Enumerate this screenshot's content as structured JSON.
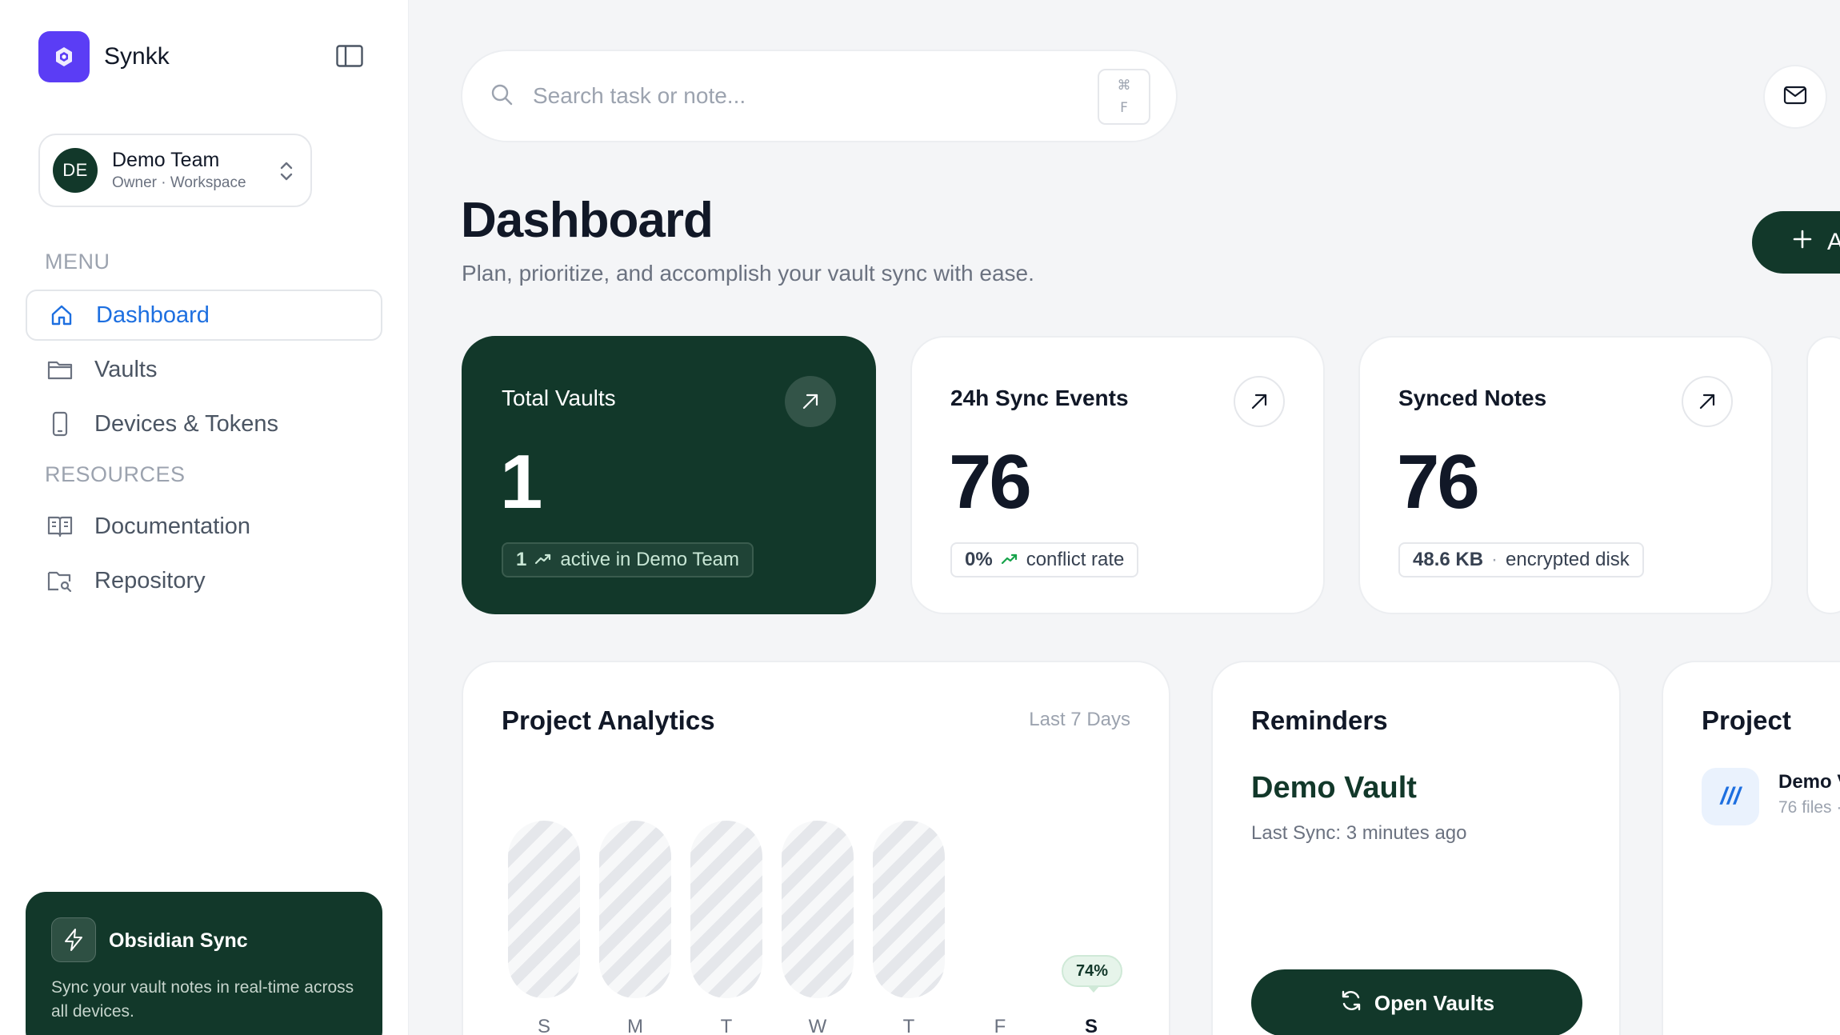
{
  "app": {
    "name": "Synkk"
  },
  "team": {
    "initials": "DE",
    "name": "Demo Team",
    "role": "Owner · Workspace"
  },
  "sidebar": {
    "menu_label": "MENU",
    "menu_items": [
      {
        "label": "Dashboard",
        "icon": "home-icon",
        "active": true
      },
      {
        "label": "Vaults",
        "icon": "folder-icon"
      },
      {
        "label": "Devices & Tokens",
        "icon": "phone-icon"
      }
    ],
    "resources_label": "RESOURCES",
    "resource_items": [
      {
        "label": "Documentation",
        "icon": "book-icon"
      },
      {
        "label": "Repository",
        "icon": "repo-icon"
      }
    ],
    "promo": {
      "title": "Obsidian Sync",
      "description": "Sync your vault notes in real-time across all devices."
    }
  },
  "search": {
    "placeholder": "Search task or note...",
    "shortcut_mod": "⌘",
    "shortcut_key": "F"
  },
  "header": {
    "title": "Dashboard",
    "subtitle": "Plan, prioritize, and accomplish your vault sync with ease.",
    "add_button_label": "A"
  },
  "stats": [
    {
      "label": "Total Vaults",
      "value": "1",
      "pill_strong": "1",
      "pill_text": "active in Demo Team",
      "trend_icon": "trend-up-icon"
    },
    {
      "label": "24h Sync Events",
      "value": "76",
      "pill_strong": "0%",
      "pill_text": "conflict rate",
      "trend_icon": "trend-up-icon"
    },
    {
      "label": "Synced Notes",
      "value": "76",
      "pill_strong": "48.6 KB",
      "pill_sep": "·",
      "pill_text": "encrypted disk"
    }
  ],
  "analytics": {
    "title": "Project Analytics",
    "range": "Last 7 Days",
    "days": [
      "S",
      "M",
      "T",
      "W",
      "T",
      "F",
      "S"
    ],
    "highlight": "74%"
  },
  "chart_data": {
    "type": "bar",
    "categories": [
      "S",
      "M",
      "T",
      "W",
      "T",
      "F",
      "S"
    ],
    "annotations": [
      {
        "category": "S",
        "text": "74%"
      }
    ]
  },
  "reminders": {
    "title": "Reminders",
    "vault": "Demo Vault",
    "last_sync": "Last Sync: 3 minutes ago",
    "button_label": "Open Vaults"
  },
  "project": {
    "title": "Project",
    "icon_text": "///",
    "item_name": "Demo V",
    "item_meta": "76 files ·"
  },
  "colors": {
    "brand": "#5b3df5",
    "primary_dark": "#12382a",
    "accent_blue": "#1d6fe0"
  }
}
